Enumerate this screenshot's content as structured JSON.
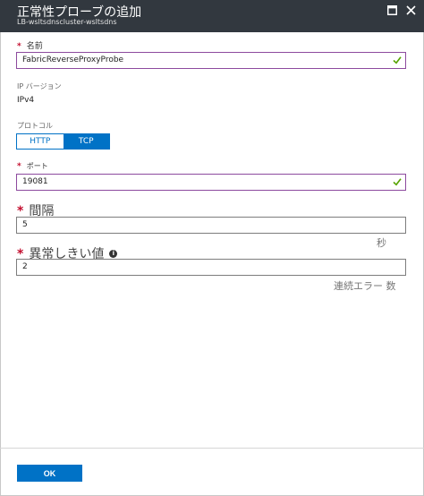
{
  "header": {
    "title": "正常性プローブの追加",
    "subtitle": "LB-wsltsdnscluster-wsltsdns",
    "maximize_icon": "maximize-icon",
    "close_icon": "close-icon"
  },
  "form": {
    "name": {
      "required_mark": "*",
      "label": "名前",
      "value": "FabricReverseProxyProbe"
    },
    "ip_version": {
      "label": "IP バージョン",
      "value": "IPv4"
    },
    "protocol": {
      "label": "プロトコル",
      "options": [
        "HTTP",
        "TCP"
      ],
      "selected": "TCP"
    },
    "port": {
      "required_mark": "*",
      "label": "ポート",
      "value": "19081"
    },
    "interval": {
      "required_mark": "*",
      "label": "間隔",
      "value": "5",
      "unit": "秒"
    },
    "unhealthy_threshold": {
      "required_mark": "*",
      "label": "異常しきい値",
      "value": "2",
      "unit": "連続エラー 数",
      "info_icon": "info-icon"
    }
  },
  "footer": {
    "ok_label": "OK"
  },
  "colors": {
    "header_bg": "#32383f",
    "accent": "#0072c6",
    "valid_border": "#8d4a9e",
    "check": "#57a300",
    "required": "#c30e2e"
  }
}
